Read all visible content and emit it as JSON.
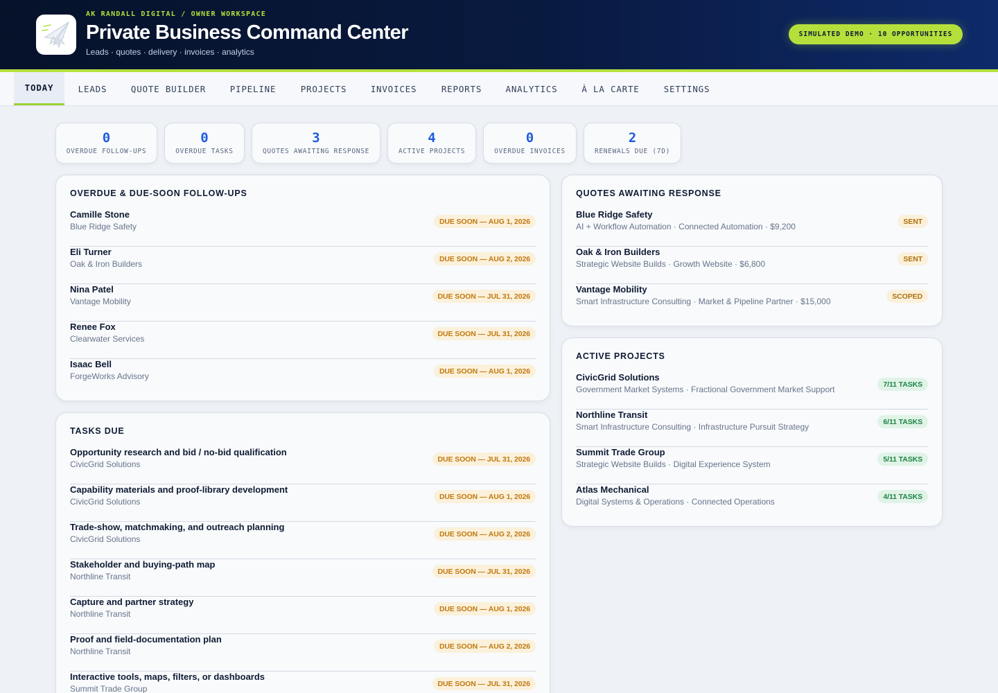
{
  "header": {
    "logo_text": "AK",
    "eyebrow": "AK RANDALL DIGITAL / OWNER WORKSPACE",
    "title": "Private Business Command Center",
    "subtitle": "Leads · quotes · delivery · invoices · analytics",
    "demo_pill": "SIMULATED DEMO · 10 OPPORTUNITIES"
  },
  "nav": {
    "tabs": [
      "TODAY",
      "LEADS",
      "QUOTE BUILDER",
      "PIPELINE",
      "PROJECTS",
      "INVOICES",
      "REPORTS",
      "ANALYTICS",
      "À LA CARTE",
      "SETTINGS"
    ],
    "active": "TODAY"
  },
  "stats": [
    {
      "value": "0",
      "label": "OVERDUE FOLLOW-UPS"
    },
    {
      "value": "0",
      "label": "OVERDUE TASKS"
    },
    {
      "value": "3",
      "label": "QUOTES AWAITING RESPONSE"
    },
    {
      "value": "4",
      "label": "ACTIVE PROJECTS"
    },
    {
      "value": "0",
      "label": "OVERDUE INVOICES"
    },
    {
      "value": "2",
      "label": "RENEWALS DUE (7D)"
    }
  ],
  "followups": {
    "title": "OVERDUE & DUE-SOON FOLLOW-UPS",
    "items": [
      {
        "name": "Camille Stone",
        "company": "Blue Ridge Safety",
        "badge": "DUE SOON — AUG 1, 2026"
      },
      {
        "name": "Eli Turner",
        "company": "Oak & Iron Builders",
        "badge": "DUE SOON — AUG 2, 2026"
      },
      {
        "name": "Nina Patel",
        "company": "Vantage Mobility",
        "badge": "DUE SOON — JUL 31, 2026"
      },
      {
        "name": "Renee Fox",
        "company": "Clearwater Services",
        "badge": "DUE SOON — JUL 31, 2026"
      },
      {
        "name": "Isaac Bell",
        "company": "ForgeWorks Advisory",
        "badge": "DUE SOON — AUG 1, 2026"
      }
    ]
  },
  "tasks": {
    "title": "TASKS DUE",
    "items": [
      {
        "name": "Opportunity research and bid / no-bid qualification",
        "company": "CivicGrid Solutions",
        "badge": "DUE SOON — JUL 31, 2026"
      },
      {
        "name": "Capability materials and proof-library development",
        "company": "CivicGrid Solutions",
        "badge": "DUE SOON — AUG 1, 2026"
      },
      {
        "name": "Trade-show, matchmaking, and outreach planning",
        "company": "CivicGrid Solutions",
        "badge": "DUE SOON — AUG 2, 2026"
      },
      {
        "name": "Stakeholder and buying-path map",
        "company": "Northline Transit",
        "badge": "DUE SOON — JUL 31, 2026"
      },
      {
        "name": "Capture and partner strategy",
        "company": "Northline Transit",
        "badge": "DUE SOON — AUG 1, 2026"
      },
      {
        "name": "Proof and field-documentation plan",
        "company": "Northline Transit",
        "badge": "DUE SOON — AUG 2, 2026"
      },
      {
        "name": "Interactive tools, maps, filters, or dashboards",
        "company": "Summit Trade Group",
        "badge": "DUE SOON — JUL 31, 2026"
      }
    ]
  },
  "quotes": {
    "title": "QUOTES AWAITING RESPONSE",
    "items": [
      {
        "name": "Blue Ridge Safety",
        "detail": "AI + Workflow Automation · Connected Automation · $9,200",
        "badge": "SENT"
      },
      {
        "name": "Oak & Iron Builders",
        "detail": "Strategic Website Builds · Growth Website · $6,800",
        "badge": "SENT"
      },
      {
        "name": "Vantage Mobility",
        "detail": "Smart Infrastructure Consulting · Market & Pipeline Partner · $15,000",
        "badge": "SCOPED"
      }
    ]
  },
  "projects": {
    "title": "ACTIVE PROJECTS",
    "items": [
      {
        "name": "CivicGrid Solutions",
        "detail": "Government Market Systems · Fractional Government Market Support",
        "badge": "7/11 TASKS"
      },
      {
        "name": "Northline Transit",
        "detail": "Smart Infrastructure Consulting · Infrastructure Pursuit Strategy",
        "badge": "6/11 TASKS"
      },
      {
        "name": "Summit Trade Group",
        "detail": "Strategic Website Builds · Digital Experience System",
        "badge": "5/11 TASKS"
      },
      {
        "name": "Atlas Mechanical",
        "detail": "Digital Systems & Operations · Connected Operations",
        "badge": "4/11 TASKS"
      }
    ]
  }
}
